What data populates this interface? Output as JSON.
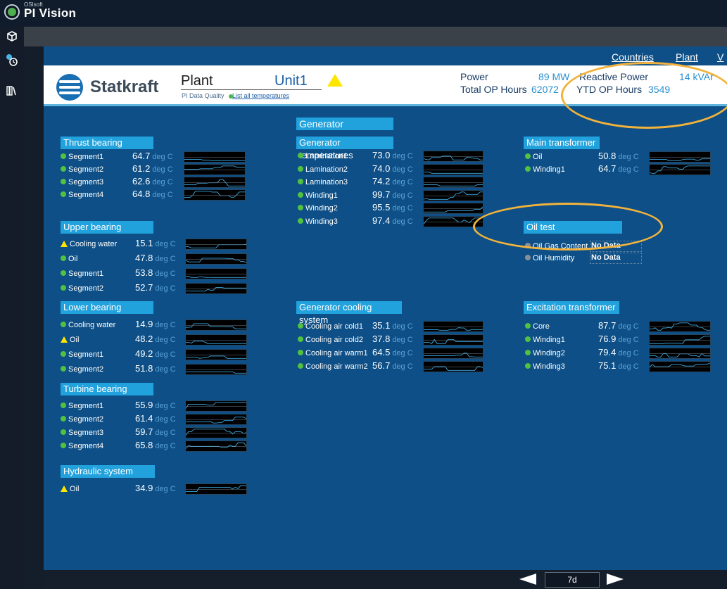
{
  "app": {
    "vendor": "OSIsoft",
    "title": "PI Vision"
  },
  "nav": [
    "Countries",
    "Plant",
    "V"
  ],
  "header": {
    "brand": "Statkraft",
    "plant": "Plant",
    "unit": "Unit1",
    "pi_quality": "PI Data Quality",
    "list_all": "List all temperatures",
    "power_label": "Power",
    "power_value": "89 MW",
    "reactive_label": "Reactive Power",
    "reactive_value": "14 kVAr",
    "total_label": "Total OP Hours",
    "total_value": "62072",
    "ytd_label": "YTD OP Hours",
    "ytd_value": "3549"
  },
  "unit_label": "deg C",
  "sections": {
    "thrust": {
      "title": "Thrust bearing",
      "rows": [
        {
          "label": "Segment1",
          "value": "64.7"
        },
        {
          "label": "Segment2",
          "value": "61.2"
        },
        {
          "label": "Segment3",
          "value": "62.6"
        },
        {
          "label": "Segment4",
          "value": "64.8"
        }
      ]
    },
    "upper": {
      "title": "Upper bearing",
      "rows": [
        {
          "label": "Cooling water",
          "value": "15.1",
          "status": "warning"
        },
        {
          "label": "Oil",
          "value": "47.8"
        },
        {
          "label": "Segment1",
          "value": "53.8"
        },
        {
          "label": "Segment2",
          "value": "52.7"
        }
      ]
    },
    "lower": {
      "title": "Lower bearing",
      "rows": [
        {
          "label": "Cooling water",
          "value": "14.9"
        },
        {
          "label": "Oil",
          "value": "48.2",
          "status": "warning"
        },
        {
          "label": "Segment1",
          "value": "49.2"
        },
        {
          "label": "Segment2",
          "value": "51.8"
        }
      ]
    },
    "turbine": {
      "title": "Turbine bearing",
      "rows": [
        {
          "label": "Segment1",
          "value": "55.9"
        },
        {
          "label": "Segment2",
          "value": "61.4"
        },
        {
          "label": "Segment3",
          "value": "59.7"
        },
        {
          "label": "Segment4",
          "value": "65.8"
        }
      ]
    },
    "hydraulic": {
      "title": "Hydraulic system",
      "rows": [
        {
          "label": "Oil",
          "value": "34.9",
          "status": "warning"
        }
      ]
    },
    "generator": {
      "title": "Generator"
    },
    "gentemp": {
      "title": "Generator temperatures",
      "rows": [
        {
          "label": "Lamination1",
          "value": "73.0"
        },
        {
          "label": "Lamination2",
          "value": "74.0"
        },
        {
          "label": "Lamination3",
          "value": "74.2"
        },
        {
          "label": "Winding1",
          "value": "99.7"
        },
        {
          "label": "Winding2",
          "value": "95.5"
        },
        {
          "label": "Winding3",
          "value": "97.4"
        }
      ]
    },
    "gencool": {
      "title": "Generator cooling system",
      "rows": [
        {
          "label": "Cooling air cold1",
          "value": "35.1"
        },
        {
          "label": "Cooling air cold2",
          "value": "37.8"
        },
        {
          "label": "Cooling air warm1",
          "value": "64.5"
        },
        {
          "label": "Cooling air warm2",
          "value": "56.7"
        }
      ]
    },
    "maintx": {
      "title": "Main transformer",
      "rows": [
        {
          "label": "Oil",
          "value": "50.8"
        },
        {
          "label": "Winding1",
          "value": "64.7"
        }
      ]
    },
    "oiltest": {
      "title": "Oil test",
      "rows": [
        {
          "label": "Oil Gas Content",
          "value": "No Data"
        },
        {
          "label": "Oil Humidity",
          "value": "No Data"
        }
      ]
    },
    "exctx": {
      "title": "Excitation transformer",
      "rows": [
        {
          "label": "Core",
          "value": "87.7"
        },
        {
          "label": "Winding1",
          "value": "76.9"
        },
        {
          "label": "Winding2",
          "value": "79.4"
        },
        {
          "label": "Winding3",
          "value": "75.1"
        }
      ]
    }
  },
  "timebar": {
    "range": "7d"
  },
  "colors": {
    "display_bg": "#0d4f86",
    "section_bg": "#22a2dd",
    "ok": "#52c141",
    "warning": "#ffe600",
    "annotation": "#f2b33d"
  }
}
